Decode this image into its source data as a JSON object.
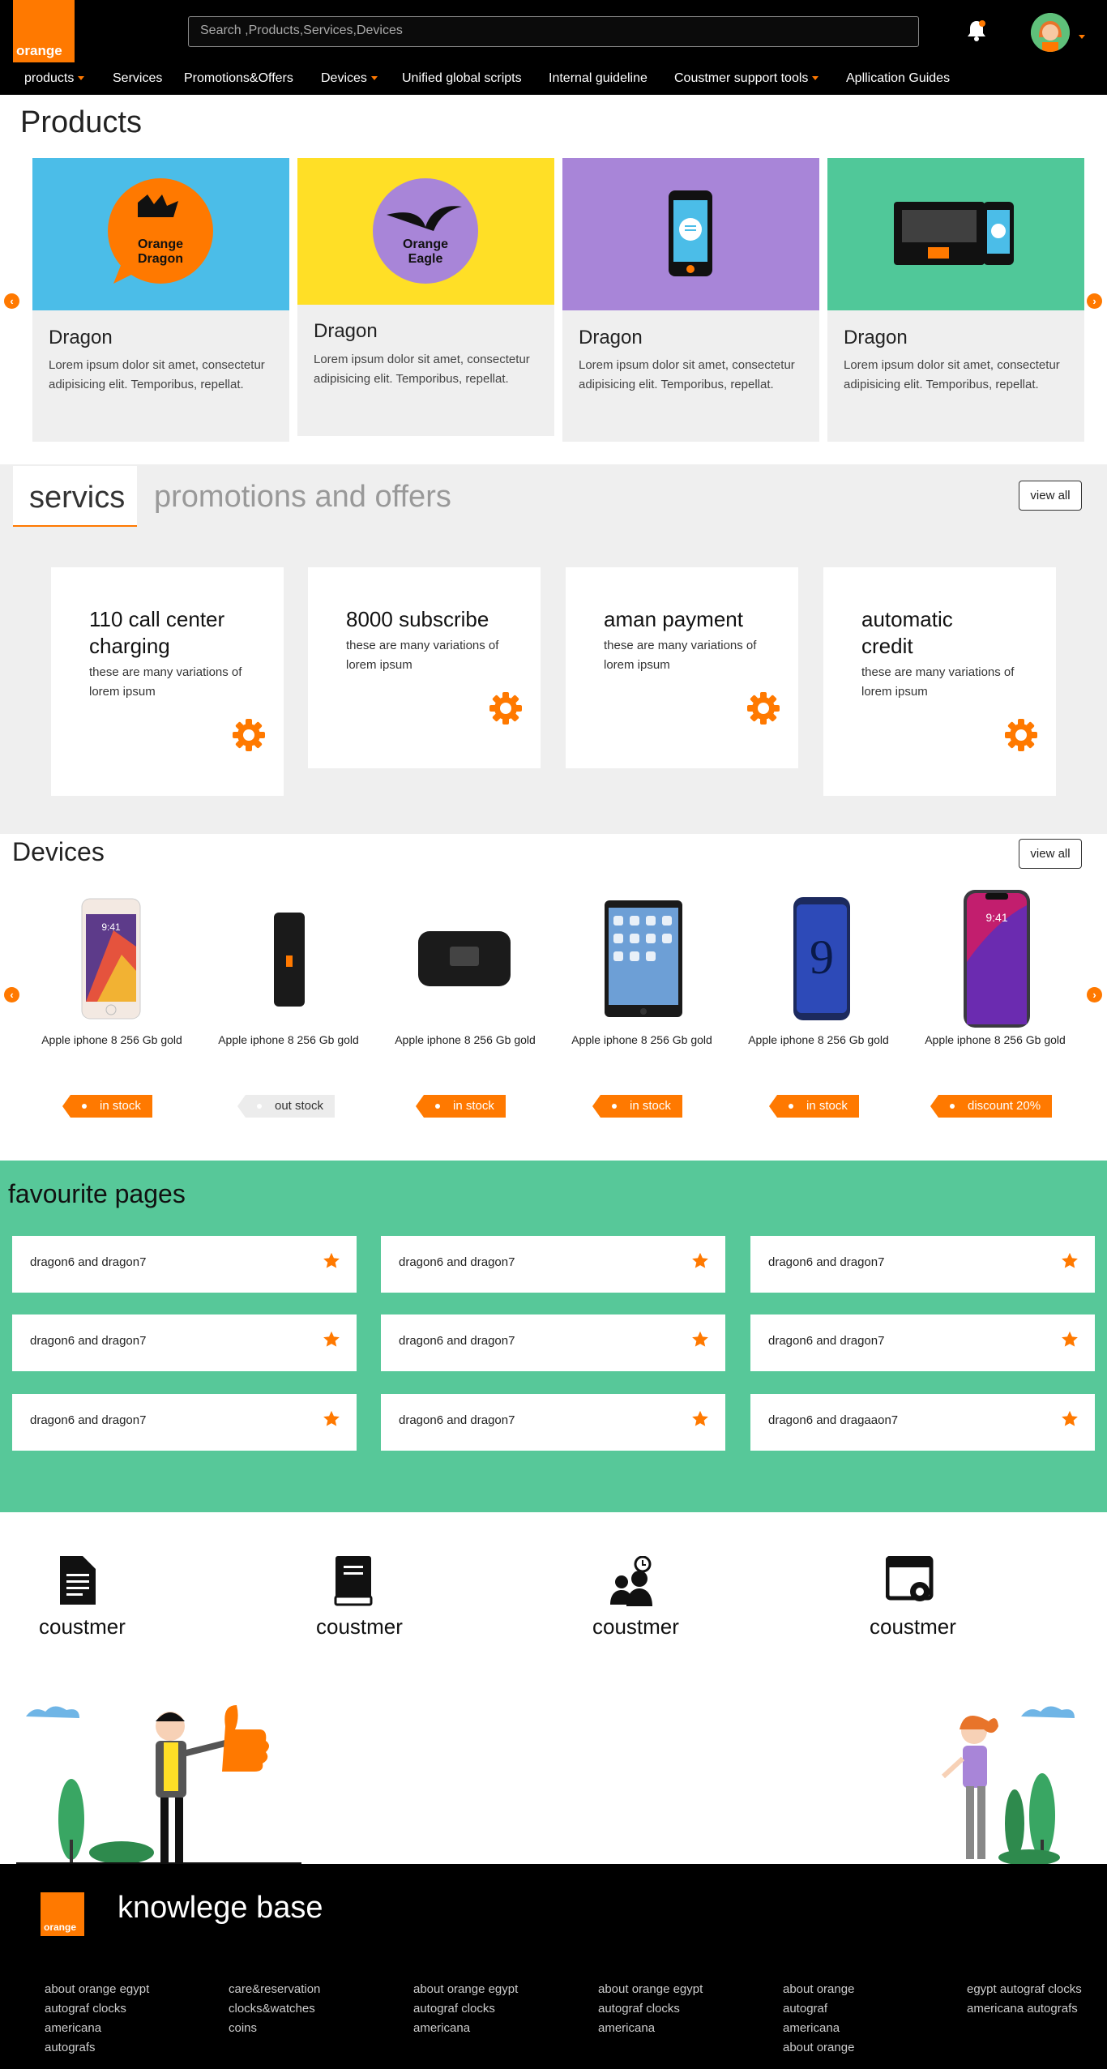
{
  "header": {
    "logo_text": "orange",
    "search_placeholder": "Search ,Products,Services,Devices",
    "nav": [
      {
        "label": "products",
        "dropdown": true
      },
      {
        "label": "Services",
        "dropdown": false
      },
      {
        "label": "Promotions&Offers",
        "dropdown": false
      },
      {
        "label": "Devices",
        "dropdown": true
      },
      {
        "label": "Unified global scripts",
        "dropdown": false
      },
      {
        "label": "Internal guideline",
        "dropdown": false
      },
      {
        "label": "Coustmer support tools",
        "dropdown": true
      },
      {
        "label": "Apllication Guides",
        "dropdown": false
      }
    ]
  },
  "colors": {
    "brand": "#ff7900",
    "favourites_bg": "#57c899"
  },
  "products": {
    "title": "Products",
    "cards": [
      {
        "title": "Dragon",
        "text": "Lorem ipsum dolor sit amet, consectetur adipisicing elit. Temporibus, repellat.",
        "image_bg": "#4bbde8",
        "badge": "Orange Dragon"
      },
      {
        "title": "Dragon",
        "text": "Lorem ipsum dolor sit amet, consectetur adipisicing elit. Temporibus, repellat.",
        "image_bg": "#ffdf26",
        "badge": "Orange Eagle"
      },
      {
        "title": "Dragon",
        "text": "Lorem ipsum dolor sit amet, consectetur adipisicing elit. Temporibus, repellat.",
        "image_bg": "#a885d8",
        "badge": ""
      },
      {
        "title": "Dragon",
        "text": "Lorem ipsum dolor sit amet, consectetur adipisicing elit. Temporibus, repellat.",
        "image_bg": "#50c899",
        "badge": ""
      }
    ]
  },
  "services": {
    "tabs": [
      "servics",
      "promotions and offers"
    ],
    "view_all": "view all",
    "cards": [
      {
        "title": "110 call center charging",
        "text": "these are many variations of lorem ipsum"
      },
      {
        "title": "8000 subscribe",
        "text": "these are many variations of lorem ipsum"
      },
      {
        "title": "aman payment",
        "text": "these are many variations of lorem ipsum"
      },
      {
        "title": "automatic credit",
        "text": "these are many variations of lorem ipsum"
      }
    ]
  },
  "devices": {
    "title": "Devices",
    "view_all": "view all",
    "items": [
      {
        "name": "Apple iphone 8 256 Gb gold",
        "status": "in stock"
      },
      {
        "name": "Apple iphone 8 256 Gb gold",
        "status": "out stock"
      },
      {
        "name": "Apple iphone 8 256 Gb gold",
        "status": "in stock"
      },
      {
        "name": "Apple iphone 8 256 Gb gold",
        "status": "in stock"
      },
      {
        "name": "Apple iphone 8 256 Gb gold",
        "status": "in stock"
      },
      {
        "name": "Apple iphone 8 256 Gb gold",
        "status": "discount 20%"
      }
    ],
    "phone_time": "9:41"
  },
  "favourites": {
    "title": "favourite pages",
    "items": [
      "dragon6 and dragon7",
      "dragon6 and dragon7",
      "dragon6 and dragon7",
      "dragon6 and dragon7",
      "dragon6 and dragon7",
      "dragon6 and dragon7",
      "dragon6 and dragon7",
      "dragon6 and dragon7",
      "dragon6 and dragaaon7"
    ]
  },
  "customers": [
    {
      "label": "coustmer",
      "icon": "document-icon"
    },
    {
      "label": "coustmer",
      "icon": "book-icon"
    },
    {
      "label": "coustmer",
      "icon": "users-clock-icon"
    },
    {
      "label": "coustmer",
      "icon": "window-gear-icon"
    }
  ],
  "footer": {
    "logo_text": "orange",
    "title": "knowlege base",
    "columns": [
      [
        "about orange egypt",
        "autograf clocks",
        "americana",
        "autografs"
      ],
      [
        "care&reservation",
        "clocks&watches",
        "coins"
      ],
      [
        "about orange egypt",
        "autograf clocks",
        "americana"
      ],
      [
        "about orange egypt",
        "autograf clocks",
        "americana"
      ],
      [
        "about orange",
        "autograf",
        "americana",
        "about orange"
      ],
      [
        "egypt autograf clocks",
        "americana autografs"
      ]
    ]
  }
}
